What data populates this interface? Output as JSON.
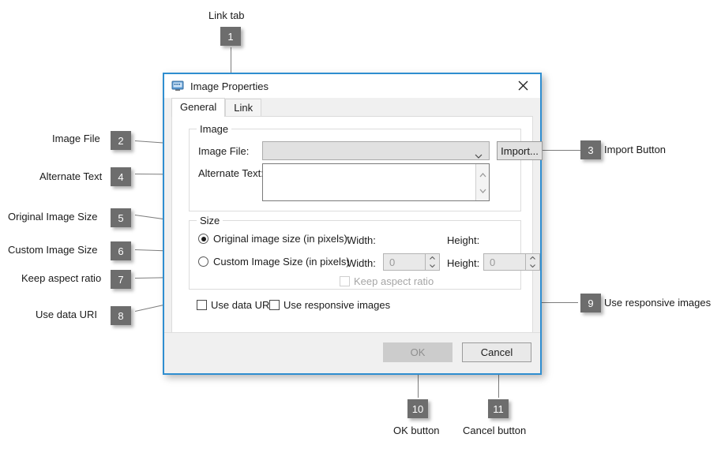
{
  "dialog": {
    "title": "Image Properties",
    "icon": "image-properties-icon",
    "close_icon": "close-icon",
    "tabs": [
      {
        "label": "General",
        "selected": true
      },
      {
        "label": "Link",
        "selected": false
      }
    ],
    "image_group": {
      "title": "Image",
      "image_file_label": "Image File:",
      "image_file_value": "",
      "image_file_placeholder": "",
      "import_button": "Import...",
      "alternate_text_label": "Alternate Text:",
      "alternate_text_value": "",
      "dropdown_icon": "chevron-down-icon",
      "scroll_up_icon": "chevron-up-icon",
      "scroll_down_icon": "chevron-down-icon"
    },
    "size_group": {
      "title": "Size",
      "original_radio_label": "Original image size (in pixels):",
      "original_selected": true,
      "original_width_label": "Width:",
      "original_height_label": "Height:",
      "original_width_value": "",
      "original_height_value": "",
      "custom_radio_label": "Custom Image Size (in pixels)",
      "custom_selected": false,
      "custom_width_label": "Width:",
      "custom_width_value": "0",
      "custom_height_label": "Height:",
      "custom_height_value": "0",
      "keep_aspect_label": "Keep aspect ratio",
      "keep_aspect_checked": false,
      "keep_aspect_enabled": false
    },
    "options": {
      "use_data_uri_label": "Use data URI",
      "use_data_uri_checked": false,
      "use_responsive_label": "Use responsive images",
      "use_responsive_checked": false
    },
    "footer": {
      "ok_label": "OK",
      "ok_enabled": false,
      "cancel_label": "Cancel",
      "cancel_enabled": true
    }
  },
  "callouts": [
    {
      "number": "1",
      "text": "Link tab"
    },
    {
      "number": "2",
      "text": "Image File"
    },
    {
      "number": "3",
      "text": "Import Button"
    },
    {
      "number": "4",
      "text": "Alternate Text"
    },
    {
      "number": "5",
      "text": "Original Image Size"
    },
    {
      "number": "6",
      "text": "Custom Image Size"
    },
    {
      "number": "7",
      "text": "Keep aspect ratio"
    },
    {
      "number": "8",
      "text": "Use data URI"
    },
    {
      "number": "9",
      "text": "Use responsive images"
    },
    {
      "number": "10",
      "text": "OK button"
    },
    {
      "number": "11",
      "text": "Cancel button"
    }
  ],
  "colors": {
    "dialog_border": "#2f8ed0",
    "badge_bg": "#6d6d6d",
    "leader_line": "#7d7d7d",
    "dialog_bg": "#f0f0f0"
  }
}
